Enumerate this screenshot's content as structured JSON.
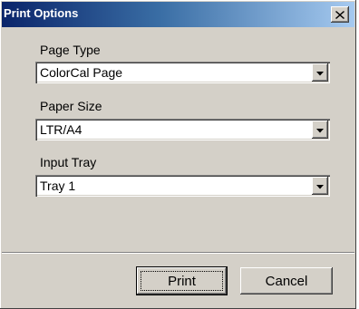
{
  "window": {
    "title": "Print Options",
    "close_icon": "close-icon"
  },
  "fields": [
    {
      "label": "Page Type",
      "value": "ColorCal Page"
    },
    {
      "label": "Paper Size",
      "value": "LTR/A4"
    },
    {
      "label": "Input Tray",
      "value": "Tray 1"
    }
  ],
  "buttons": {
    "print": "Print",
    "cancel": "Cancel"
  },
  "colors": {
    "title_start": "#0a246a",
    "title_end": "#a6caf0",
    "face": "#d4d0c8"
  }
}
